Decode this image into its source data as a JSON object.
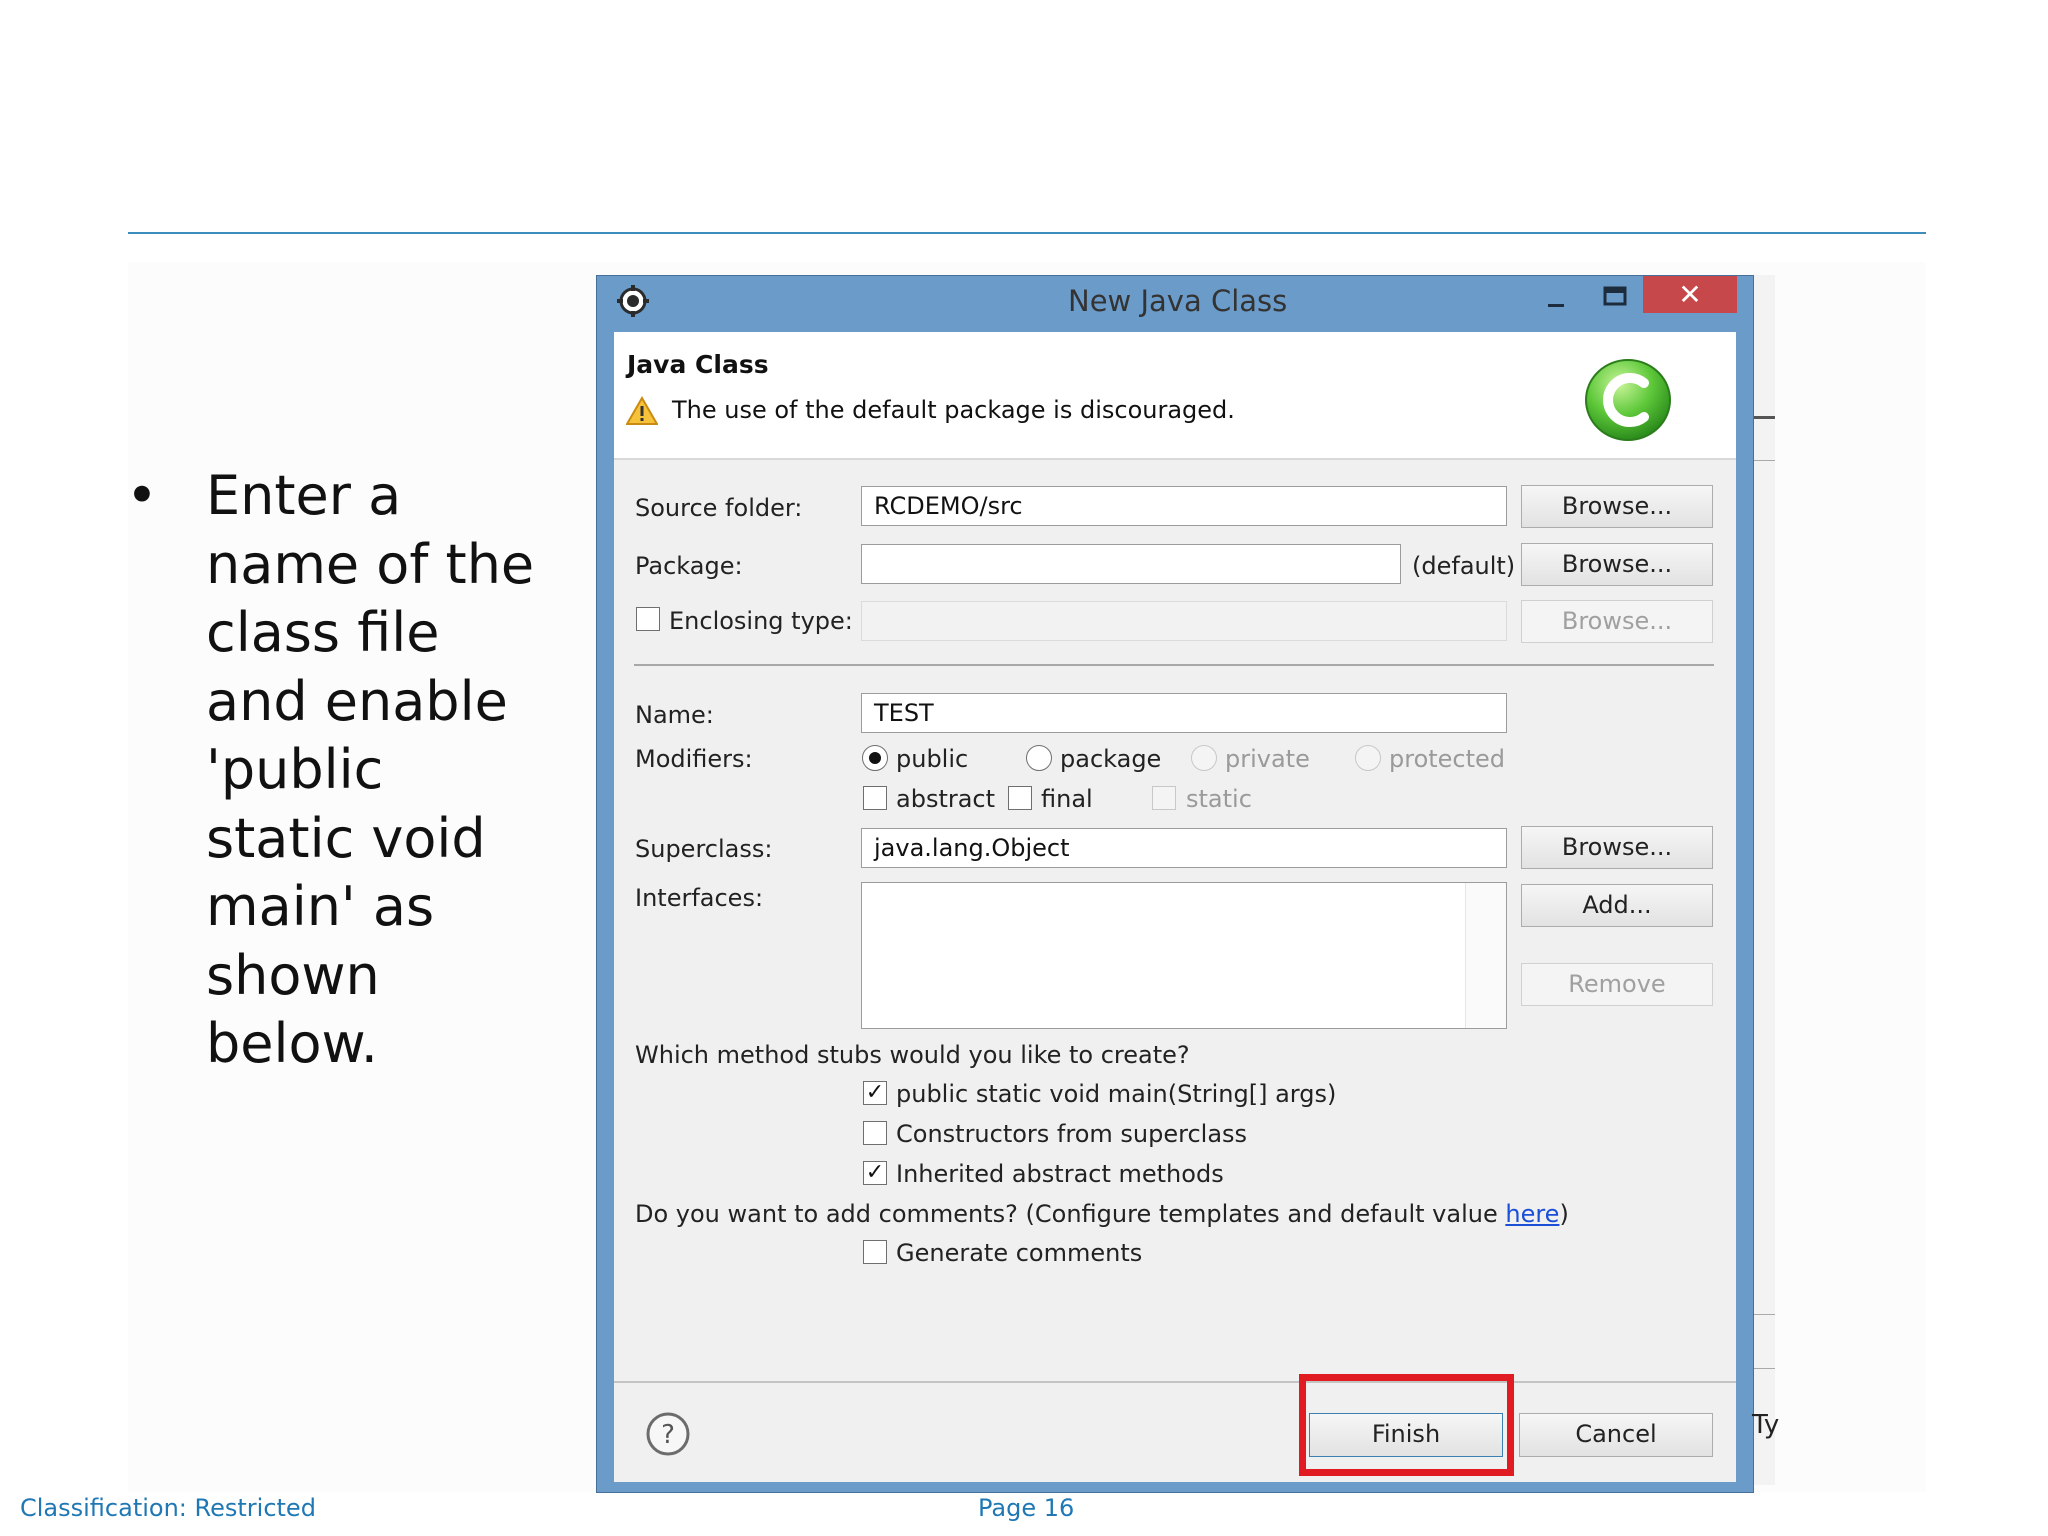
{
  "slide": {
    "bullet_symbol": "•",
    "bullet_lines": [
      "Enter a",
      "name of the",
      "class file",
      "and enable",
      "'public",
      "static void",
      "main' as",
      "shown",
      "below."
    ],
    "footer_classification": "Classification: Restricted",
    "footer_page": "Page 16",
    "background_window_fragment": "Ty"
  },
  "dialog": {
    "title": "New Java Class",
    "window_controls": {
      "minimize": "–",
      "close": "✕"
    },
    "header_title": "Java Class",
    "header_message": "The use of the default package is discouraged.",
    "source_folder": {
      "label": "Source folder:",
      "value": "RCDEMO/src",
      "button": "Browse..."
    },
    "package": {
      "label": "Package:",
      "value": "",
      "suffix": "(default)",
      "button": "Browse..."
    },
    "enclosing_type": {
      "label": "Enclosing type:",
      "checked": false,
      "value": "",
      "button": "Browse..."
    },
    "name": {
      "label": "Name:",
      "value": "TEST"
    },
    "modifiers": {
      "label": "Modifiers:",
      "access": [
        "public",
        "package",
        "private",
        "protected"
      ],
      "selected_access": "public",
      "other": [
        "abstract",
        "final",
        "static"
      ]
    },
    "superclass": {
      "label": "Superclass:",
      "value": "java.lang.Object",
      "button": "Browse..."
    },
    "interfaces": {
      "label": "Interfaces:",
      "add_button": "Add...",
      "remove_button": "Remove"
    },
    "stubs": {
      "question": "Which method stubs would you like to create?",
      "items": [
        {
          "label": "public static void main(String[] args)",
          "checked": true,
          "check_glyph": "✓"
        },
        {
          "label": "Constructors from superclass",
          "checked": false,
          "check_glyph": ""
        },
        {
          "label": "Inherited abstract methods",
          "checked": true,
          "check_glyph": "✓"
        }
      ]
    },
    "comments": {
      "question_prefix": "Do you want to add comments? (Configure templates and default value ",
      "link": "here",
      "question_suffix": ")",
      "generate_label": "Generate comments",
      "checked": false
    },
    "help_glyph": "?",
    "finish_button": "Finish",
    "cancel_button": "Cancel",
    "highlight_color": "#e01b22",
    "frame_color": "#6b9cc9"
  }
}
